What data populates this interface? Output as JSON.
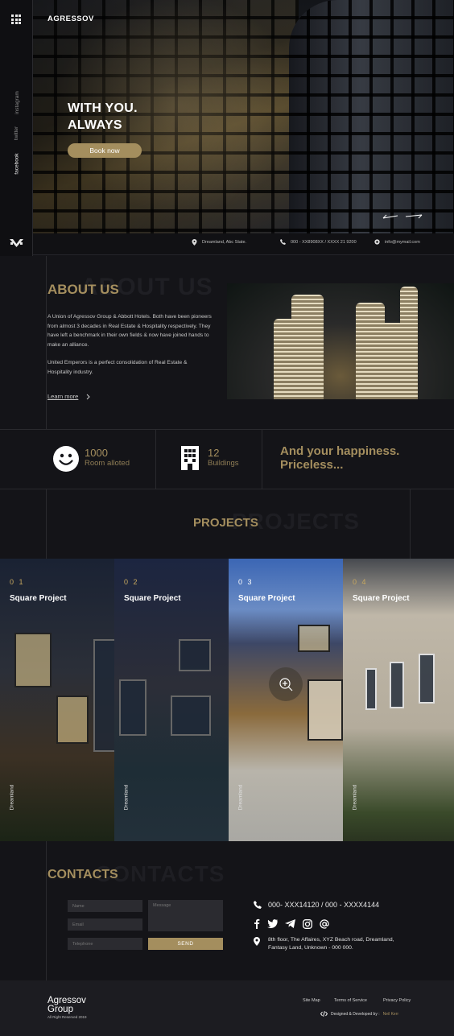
{
  "sidebar": {
    "social": [
      "instagram",
      "twitter",
      "facebook"
    ]
  },
  "hero": {
    "brand": "AGRESSOV",
    "title_line1": "WITH YOU.",
    "title_line2": "ALWAYS",
    "cta": "Book now"
  },
  "info": {
    "address": "Dreamland, Abc State.",
    "phone": "000 - XX8908XX / XXXX 21 9200",
    "email": "info@mymail.com"
  },
  "about": {
    "ghost": "ABOUT US",
    "title": "ABOUT US",
    "p1": "A Union of Agressov Group & Abbott Hotels. Both have been pioneers from almost 3 decades in Real Estate & Hospitality respectively. They have left a benchmark in their own fields & now have joined  hands to make an alliance.",
    "p2": "United Emperors is a perfect consolidation of Real Estate & Hospitality industry.",
    "learn_more": "Learn more"
  },
  "stats": [
    {
      "value": "1000",
      "label": "Room alloted",
      "icon": "smiley-icon"
    },
    {
      "value": "12",
      "label": "Buildings",
      "icon": "building-icon"
    }
  ],
  "tagline_line1": "And your happiness.",
  "tagline_line2": "Priceless...",
  "projects": {
    "ghost": "PROJECTS",
    "title": "PROJECTS",
    "items": [
      {
        "num": "0 1",
        "title": "Square Project",
        "location": "Dreamland"
      },
      {
        "num": "0 2",
        "title": "Square Project",
        "location": "Dreamland"
      },
      {
        "num": "0 3",
        "title": "Square Project",
        "location": "Dreamland"
      },
      {
        "num": "0 4",
        "title": "Square Project",
        "location": "Dreamland"
      }
    ]
  },
  "contacts": {
    "ghost": "CONTACTS",
    "title": "CONTACTS",
    "form": {
      "name_placeholder": "Name",
      "email_placeholder": "Email",
      "telephone_placeholder": "Telephone",
      "message_placeholder": "Message",
      "send": "SEND"
    },
    "phone": "000- XXX14120 / 000 - XXXX4144",
    "address_line1": "8th floor, The Affaires, XYZ Beach road, Dreamland,",
    "address_line2": "Fantasy Land, Unknown - 000 000."
  },
  "footer": {
    "brand_line1": "Agressov",
    "brand_line2": "Group",
    "rights": "All Right Reserved 2019",
    "links": [
      "Site Map",
      "Terms of Service",
      "Privacy Policy"
    ],
    "credit_prefix": "Designed & Developed by :",
    "credit_name": "Neil Kerr"
  },
  "colors": {
    "accent": "#a48e5e",
    "background": "#141418",
    "footer": "#1c1c21"
  }
}
